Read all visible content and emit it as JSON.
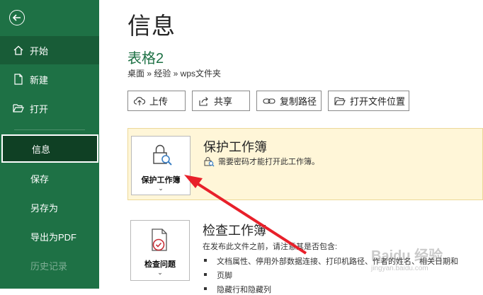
{
  "sidebar": {
    "items": [
      {
        "label": "开始"
      },
      {
        "label": "新建"
      },
      {
        "label": "打开"
      },
      {
        "label": "信息"
      },
      {
        "label": "保存"
      },
      {
        "label": "另存为"
      },
      {
        "label": "导出为PDF"
      },
      {
        "label": "历史记录"
      }
    ]
  },
  "main": {
    "page_title": "信息",
    "file_name": "表格2",
    "breadcrumb": "桌面 » 经验 » wps文件夹",
    "toolbar": [
      {
        "label": "上传"
      },
      {
        "label": "共享"
      },
      {
        "label": "复制路径"
      },
      {
        "label": "打开文件位置"
      }
    ],
    "protect": {
      "tile_label": "保护工作簿",
      "title": "保护工作簿",
      "description": "需要密码才能打开此工作簿。"
    },
    "inspect": {
      "tile_label": "检查问题",
      "title": "检查工作簿",
      "intro": "在发布此文件之前，请注意其是否包含:",
      "bullets": [
        "文档属性、停用外部数据连接、打印机路径、作者的姓名、相关日期和",
        "页脚",
        "隐藏行和隐藏列"
      ]
    },
    "watermark": {
      "brand": "Baidu 经验",
      "url": "jingyan.baidu.com"
    },
    "colors": {
      "sidebar": "#1e7145",
      "accent": "#1e7145",
      "highlight": "#fff6d8",
      "arrow": "#e8202a"
    }
  }
}
